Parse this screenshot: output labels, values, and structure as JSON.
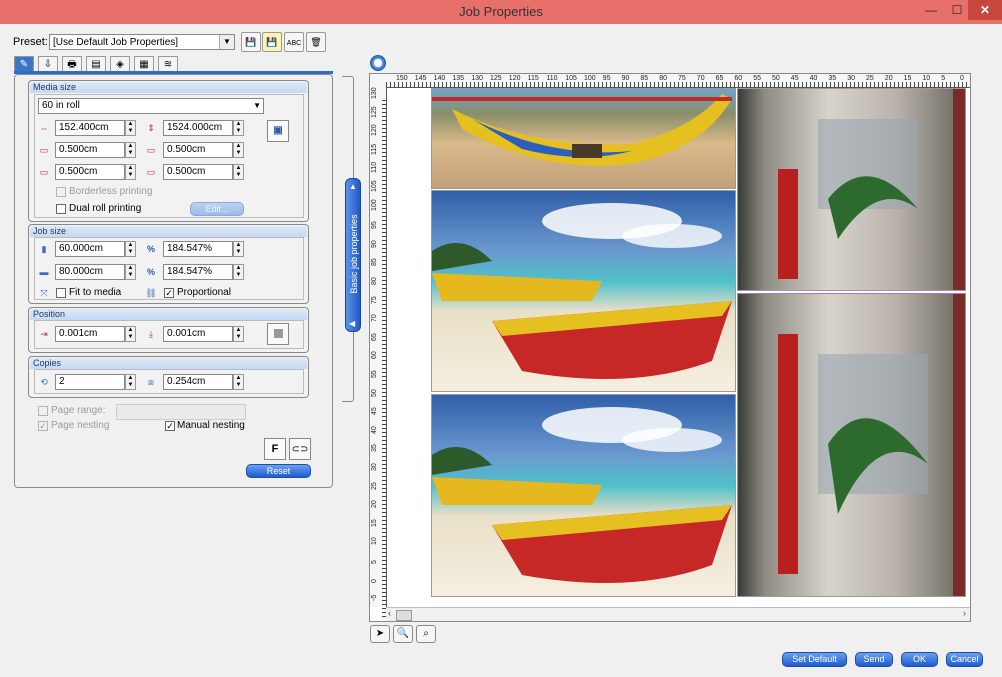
{
  "window": {
    "title": "Job Properties",
    "controls": {
      "minimize": "—",
      "maximize": "☐",
      "close": "✕"
    }
  },
  "preset": {
    "label": "Preset:",
    "value": "[Use Default Job Properties]",
    "toolbar_icons": [
      "save-icon",
      "save-as-icon",
      "spellcheck-icon",
      "delete-icon"
    ]
  },
  "tabs": [
    {
      "icon": "job-properties-icon",
      "active": true
    },
    {
      "icon": "import-icon",
      "active": false
    },
    {
      "icon": "printer-icon",
      "active": false
    },
    {
      "icon": "print-head-icon",
      "active": false
    },
    {
      "icon": "color-adjust-icon",
      "active": false
    },
    {
      "icon": "color-palette-icon",
      "active": false
    },
    {
      "icon": "stack-icon",
      "active": false
    }
  ],
  "media_size": {
    "title": "Media size",
    "roll": "60 in roll",
    "width": "152.400cm",
    "length": "1524.000cm",
    "margin_left": "0.500cm",
    "margin_right": "0.500cm",
    "margin_top": "0.500cm",
    "margin_bottom": "0.500cm",
    "borderless_label": "Borderless printing",
    "borderless_checked": false,
    "dual_roll_label": "Dual roll printing",
    "dual_roll_checked": false,
    "edit_label": "Edit..."
  },
  "job_size": {
    "title": "Job size",
    "width": "60.000cm",
    "height": "80.000cm",
    "scale_x": "184.547%",
    "scale_y": "184.547%",
    "percent_symbol": "%",
    "fit_label": "Fit to media",
    "fit_checked": false,
    "proportional_label": "Proportional",
    "proportional_checked": true
  },
  "position": {
    "title": "Position",
    "x": "0.001cm",
    "y": "0.001cm"
  },
  "copies": {
    "title": "Copies",
    "count": "2",
    "gap": "0.254cm"
  },
  "options": {
    "page_range_label": "Page range:",
    "page_range_checked": false,
    "page_nesting_label": "Page nesting",
    "page_nesting_checked": true,
    "manual_nesting_label": "Manual nesting",
    "manual_nesting_checked": true,
    "font_button": "F",
    "reset_label": "Reset"
  },
  "side_tab": {
    "label": "Basic job properties"
  },
  "ruler": {
    "top": [
      "150",
      "145",
      "140",
      "135",
      "130",
      "125",
      "120",
      "115",
      "110",
      "105",
      "100",
      "95",
      "90",
      "85",
      "80",
      "75",
      "70",
      "65",
      "60",
      "55",
      "50",
      "45",
      "40",
      "35",
      "30",
      "25",
      "20",
      "15",
      "10",
      "5",
      "0"
    ],
    "left": [
      "130",
      "125",
      "120",
      "115",
      "110",
      "105",
      "100",
      "95",
      "90",
      "85",
      "80",
      "75",
      "70",
      "65",
      "60",
      "55",
      "50",
      "45",
      "40",
      "35",
      "30",
      "25",
      "20",
      "15",
      "10",
      "5",
      "0",
      "-5"
    ]
  },
  "preview_tools": [
    "pointer-icon",
    "zoom-icon",
    "zoom-fit-icon"
  ],
  "footer": {
    "set_default": "Set Default",
    "send": "Send",
    "ok": "OK",
    "cancel": "Cancel"
  }
}
